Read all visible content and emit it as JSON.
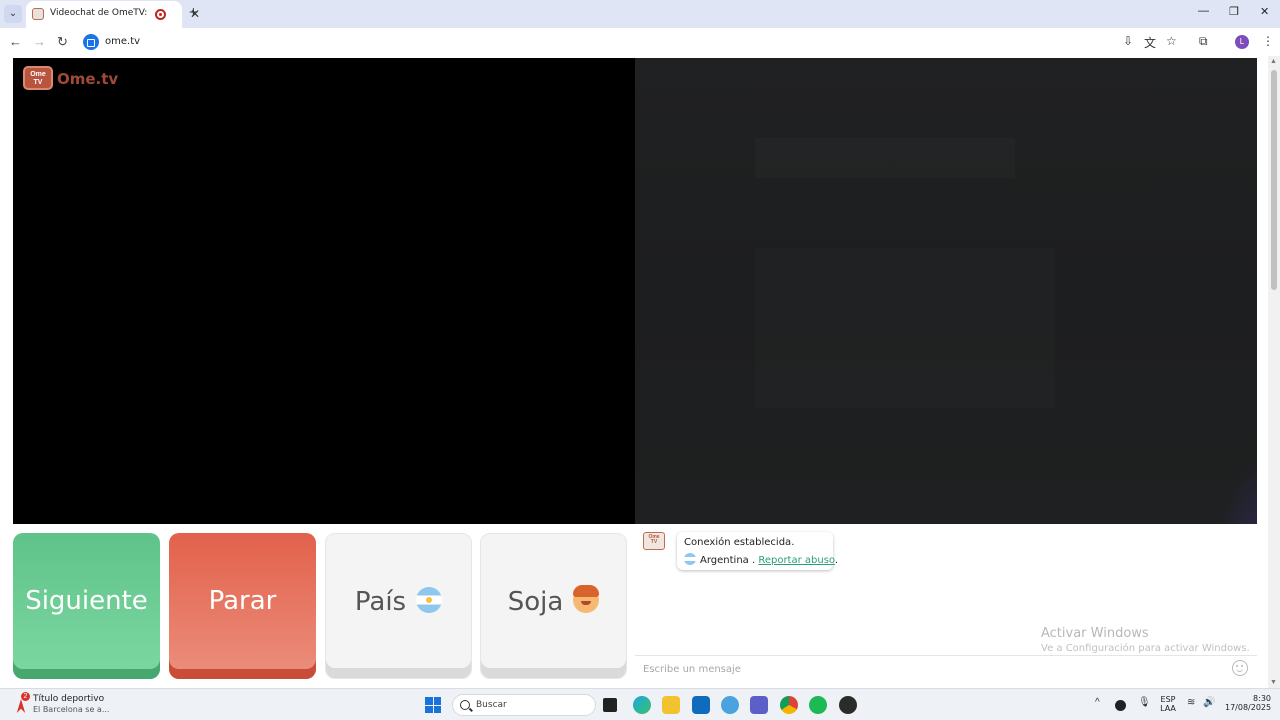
{
  "browser": {
    "tab_title": "Videochat de OmeTV: una",
    "url": "ome.tv",
    "profile_initial": "L"
  },
  "page": {
    "logo_text": "Ome.tv",
    "logo_badge": "Ome TV",
    "buttons": {
      "next": "Siguiente",
      "stop": "Parar",
      "country": "País",
      "gender": "Soja"
    },
    "chat": {
      "avatar_label": "Ome TV",
      "status": "Conexión establecida.",
      "country": "Argentina .",
      "report_link": "Reportar abuso",
      "report_suffix": ".",
      "input_placeholder": "Escribe un mensaje"
    },
    "watermark": {
      "title": "Activar Windows",
      "subtitle": "Ve a Configuración para activar Windows."
    }
  },
  "taskbar": {
    "news_badge": "2",
    "news_title": "Título deportivo",
    "news_subtitle": "El Barcelona se a...",
    "search_label": "Buscar",
    "lang_top": "ESP",
    "lang_bottom": "LAA",
    "time": "8:30",
    "date": "17/08/2025"
  }
}
